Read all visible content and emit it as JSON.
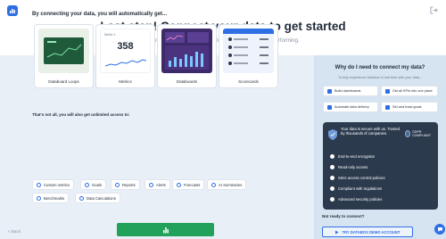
{
  "header": {
    "title": "Last step! Connect your data to get started",
    "subtitle": "Centralize all your data and always know how you're performing."
  },
  "main": {
    "heading": "By connecting your data, you will automatically get...",
    "cards": [
      {
        "label": "Databoard Loops"
      },
      {
        "label": "Metrics"
      },
      {
        "label": "Databoards"
      },
      {
        "label": "Scorecards"
      }
    ],
    "metric_card": {
      "title": "Metric 1",
      "value": "358"
    },
    "unlimited_heading": "That's not all, you will also get unlimited access to:",
    "chips": [
      {
        "label": "Custom metrics"
      },
      {
        "label": "Goals"
      },
      {
        "label": "Reports"
      },
      {
        "label": "Alerts"
      },
      {
        "label": "Forecasts"
      },
      {
        "label": "AI Summaries"
      },
      {
        "label": "Benchmarks"
      },
      {
        "label": "Data Calculations"
      }
    ]
  },
  "footer": {
    "back_label": "< Back"
  },
  "sidebar": {
    "heading": "Why do I need to connect my data?",
    "subheading": "To fully experience Databox in real time with your data...",
    "items": [
      {
        "label": "Build dashboards"
      },
      {
        "label": "Get all KPIs into one place"
      },
      {
        "label": "Automate data delivery"
      },
      {
        "label": "Set and track goals"
      }
    ],
    "secure": {
      "title": "Your data is secure with us. Trusted by thousands of companies.",
      "gdpr": "GDPR COMPLIANT",
      "items": [
        {
          "label": "End-to-end encryption"
        },
        {
          "label": "Read-only access"
        },
        {
          "label": "Strict access control policies"
        },
        {
          "label": "Compliant with regulations"
        },
        {
          "label": "Advanced security policies"
        }
      ]
    },
    "not_ready": "Not ready to connect?",
    "demo_button": "TRY DATABOX DEMO ACCOUNT"
  },
  "colors": {
    "accent": "#2f6fe4",
    "next_button": "#22a15a",
    "panel": "#e9eff6",
    "sidebar_panel": "#d6e3f1",
    "secure_card": "#2b3a4d"
  }
}
